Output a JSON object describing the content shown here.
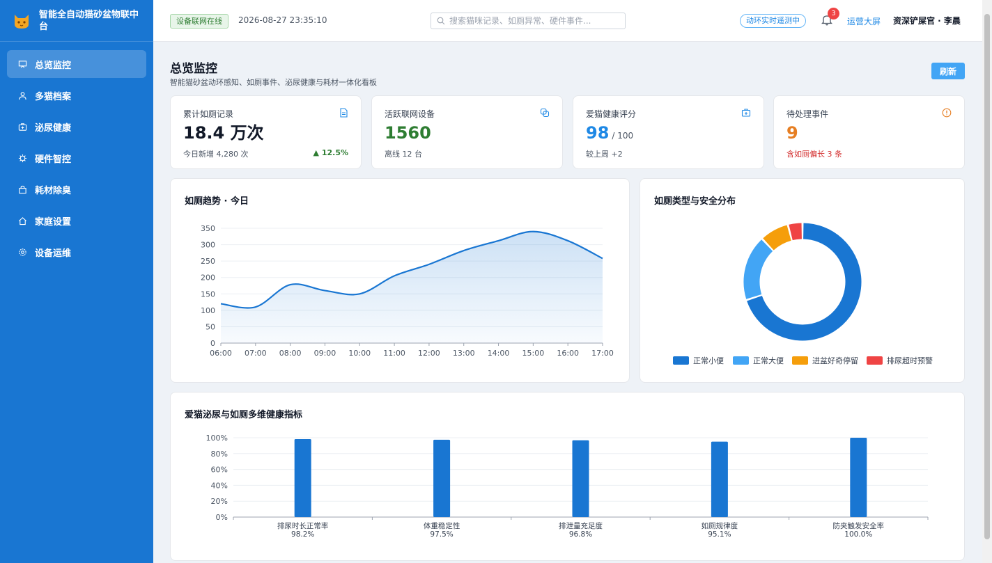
{
  "app": {
    "title_line1": "智能全自动猫砂盆物联中",
    "title_line2": "台"
  },
  "sidebar": {
    "items": [
      {
        "label": "总览监控",
        "icon": "monitor-icon",
        "active": true
      },
      {
        "label": "多猫档案",
        "icon": "user-icon"
      },
      {
        "label": "泌尿健康",
        "icon": "medical-kit-icon"
      },
      {
        "label": "硬件智控",
        "icon": "chip-icon"
      },
      {
        "label": "耗材除臭",
        "icon": "bag-icon"
      },
      {
        "label": "家庭设置",
        "icon": "home-icon"
      },
      {
        "label": "设备运维",
        "icon": "gear-icon"
      }
    ]
  },
  "topbar": {
    "status_badge": "设备联网在线",
    "datetime": "2026-08-27 23:35:10",
    "search_placeholder": "搜索猫咪记录、如厕异常、硬件事件...",
    "realtime_label": "动环实时遥测中",
    "notification_count": "3",
    "big_screen": "运营大屏",
    "user": "资深铲屎官 · 李晨"
  },
  "page": {
    "title": "总览监控",
    "subtitle": "智能猫砂盆动环感知、如厕事件、泌尿健康与耗材一体化看板",
    "refresh_label": "刷新"
  },
  "kpis": [
    {
      "label": "累计如厕记录",
      "value": "18.4 万次",
      "foot": "今日新增 4,280 次",
      "trend": "▲ 12.5%",
      "icon": "document-icon",
      "color": "#111827"
    },
    {
      "label": "活跃联网设备",
      "value": "1560",
      "foot": "离线 12 台",
      "icon": "link-icon",
      "color": "#2e7d32"
    },
    {
      "label": "爱猫健康评分",
      "value": "98",
      "denom": "/ 100",
      "foot": "较上周 +2",
      "icon": "medical-kit-icon",
      "color": "#1e88e5"
    },
    {
      "label": "待处理事件",
      "value": "9",
      "foot": "含如厕偏长 3 条",
      "icon": "alert-icon",
      "color": "#e67e22",
      "foot_color": "#d32f2f"
    }
  ],
  "trend_card": {
    "title": "如厕趋势 · 今日"
  },
  "donut_card": {
    "title": "如厕类型与安全分布"
  },
  "health_card": {
    "title": "爱猫泌尿与如厕多维健康指标"
  },
  "chart_data": [
    {
      "type": "area",
      "title": "如厕趋势 · 今日",
      "x": [
        "06:00",
        "07:00",
        "08:00",
        "09:00",
        "10:00",
        "11:00",
        "12:00",
        "13:00",
        "14:00",
        "15:00",
        "16:00",
        "17:00"
      ],
      "y": [
        120,
        110,
        178,
        160,
        150,
        205,
        240,
        282,
        312,
        340,
        312,
        258
      ],
      "ylim": [
        0,
        350
      ],
      "yticks": [
        0,
        50,
        100,
        150,
        200,
        250,
        300,
        350
      ],
      "grid": true,
      "color": "#1976d2"
    },
    {
      "type": "pie",
      "title": "如厕类型与安全分布",
      "categories": [
        "正常小便",
        "正常大便",
        "进盆好奇停留",
        "排尿超时预警"
      ],
      "values": [
        70,
        18,
        8,
        4
      ],
      "colors": [
        "#1976d2",
        "#42a5f5",
        "#f59e0b",
        "#ef4444"
      ],
      "legend": "bottom"
    },
    {
      "type": "bar",
      "title": "爱猫泌尿与如厕多维健康指标",
      "categories": [
        "排尿时长正常率",
        "体重稳定性",
        "排泄量充足度",
        "如厕规律度",
        "防夹触发安全率"
      ],
      "values": [
        98.2,
        97.5,
        96.8,
        95.1,
        100.0
      ],
      "value_labels": [
        "98.2%",
        "97.5%",
        "96.8%",
        "95.1%",
        "100.0%"
      ],
      "ylim": [
        0,
        100
      ],
      "yticks": [
        "0%",
        "20%",
        "40%",
        "60%",
        "80%",
        "100%"
      ],
      "color": "#1976d2"
    }
  ]
}
